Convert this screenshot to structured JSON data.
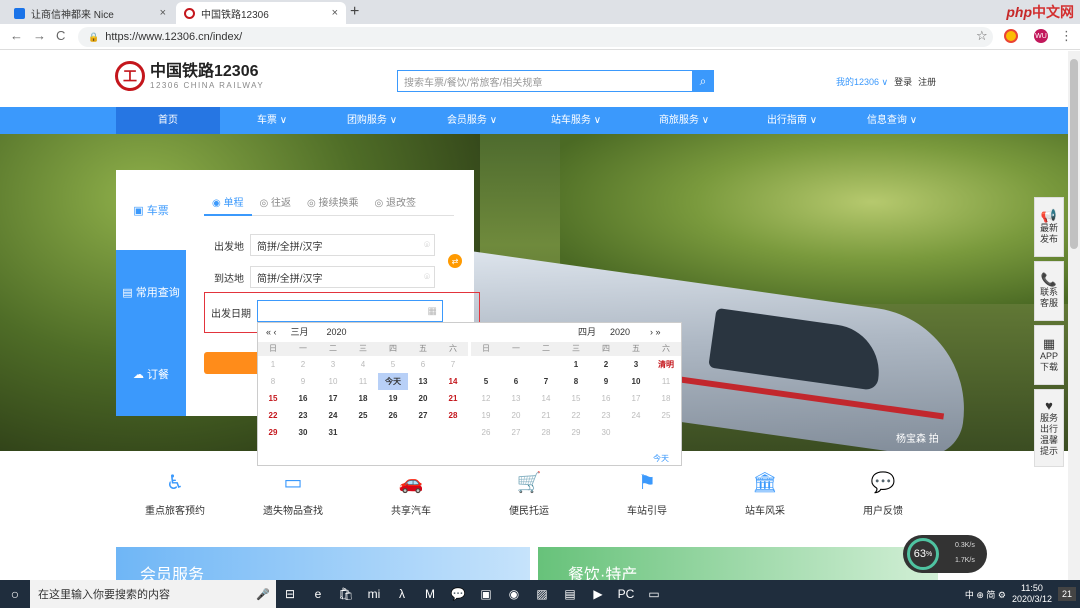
{
  "browser": {
    "tabs": [
      {
        "title": "让商信神都来 Nice"
      },
      {
        "title": "中国铁路12306"
      }
    ],
    "new_tab": "+",
    "close": "×",
    "url": "https://www.12306.cn/index/",
    "lock": "🔒",
    "nav_back": "←",
    "nav_forward": "→",
    "nav_reload": "C",
    "star": "☆",
    "ext_label": "WU",
    "menu": "⋮",
    "php_logo": {
      "a": "php",
      "b": "中文网"
    }
  },
  "site": {
    "brand_title": "中国铁路12306",
    "brand_sub": "12306 CHINA RAILWAY",
    "search_placeholder": "搜索车票/餐饮/常旅客/相关规章",
    "my_account": "我的12306 ∨",
    "login": "登录",
    "register": "注册",
    "nav": [
      "首页",
      "车票 ∨",
      "团购服务 ∨",
      "会员服务 ∨",
      "站车服务 ∨",
      "商旅服务 ∨",
      "出行指南 ∨",
      "信息查询 ∨"
    ],
    "hero_caption": "杨宝森  拍"
  },
  "sidebar": [
    {
      "icon": "📢",
      "label": "最新\n发布"
    },
    {
      "icon": "📞",
      "label": "联系\n客服"
    },
    {
      "icon": "▦",
      "label": "APP\n下载"
    },
    {
      "icon": "♥",
      "label": "服务\n出行\n温馨\n提示"
    }
  ],
  "booking": {
    "left_tabs": [
      {
        "icon": "▣",
        "label": "车票"
      },
      {
        "icon": "▤",
        "label": "常用查询"
      },
      {
        "icon": "☁",
        "label": "订餐"
      }
    ],
    "trip_tabs": [
      "◉ 单程",
      "◎ 往返",
      "◎ 接续换乘",
      "◎ 退改签"
    ],
    "from_label": "出发地",
    "from_placeholder": "简拼/全拼/汉字",
    "to_label": "到达地",
    "to_placeholder": "简拼/全拼/汉字",
    "swap": "⇄",
    "date_label": "出发日期",
    "date_icon": "▦"
  },
  "calendar": {
    "left": {
      "prev": "«  ‹",
      "month": "三月",
      "year": "2020"
    },
    "right": {
      "month": "四月",
      "year": "2020",
      "next": "›  »"
    },
    "dow": [
      "日",
      "一",
      "二",
      "三",
      "四",
      "五",
      "六"
    ],
    "march": [
      [
        "1",
        "dim"
      ],
      [
        "2",
        "dim"
      ],
      [
        "3",
        "dim"
      ],
      [
        "4",
        "dim"
      ],
      [
        "5",
        "dim"
      ],
      [
        "6",
        "dim"
      ],
      [
        "7",
        "dim"
      ],
      [
        "8",
        "dim"
      ],
      [
        "9",
        "dim"
      ],
      [
        "10",
        "dim"
      ],
      [
        "11",
        "dim"
      ],
      [
        "今天",
        "today"
      ],
      [
        "13",
        ""
      ],
      [
        "14",
        "we"
      ],
      [
        "15",
        "we"
      ],
      [
        "16",
        ""
      ],
      [
        "17",
        ""
      ],
      [
        "18",
        ""
      ],
      [
        "19",
        ""
      ],
      [
        "20",
        ""
      ],
      [
        "21",
        "we"
      ],
      [
        "22",
        "we"
      ],
      [
        "23",
        ""
      ],
      [
        "24",
        ""
      ],
      [
        "25",
        ""
      ],
      [
        "26",
        ""
      ],
      [
        "27",
        ""
      ],
      [
        "28",
        "we"
      ],
      [
        "29",
        "we"
      ],
      [
        "30",
        ""
      ],
      [
        "31",
        ""
      ],
      [
        "",
        ""
      ],
      [
        "",
        ""
      ],
      [
        "",
        ""
      ],
      [
        "",
        ""
      ]
    ],
    "april": [
      [
        "",
        ""
      ],
      [
        "",
        ""
      ],
      [
        "",
        ""
      ],
      [
        "1",
        ""
      ],
      [
        "2",
        ""
      ],
      [
        "3",
        ""
      ],
      [
        "清明",
        "we"
      ],
      [
        "5",
        ""
      ],
      [
        "6",
        ""
      ],
      [
        "7",
        ""
      ],
      [
        "8",
        ""
      ],
      [
        "9",
        ""
      ],
      [
        "10",
        ""
      ],
      [
        "11",
        "dim"
      ],
      [
        "12",
        "dim"
      ],
      [
        "13",
        "dim"
      ],
      [
        "14",
        "dim"
      ],
      [
        "15",
        "dim"
      ],
      [
        "16",
        "dim"
      ],
      [
        "17",
        "dim"
      ],
      [
        "18",
        "dim"
      ],
      [
        "19",
        "dim"
      ],
      [
        "20",
        "dim"
      ],
      [
        "21",
        "dim"
      ],
      [
        "22",
        "dim"
      ],
      [
        "23",
        "dim"
      ],
      [
        "24",
        "dim"
      ],
      [
        "25",
        "dim"
      ],
      [
        "26",
        "dim"
      ],
      [
        "27",
        "dim"
      ],
      [
        "28",
        "dim"
      ],
      [
        "29",
        "dim"
      ],
      [
        "30",
        "dim"
      ],
      [
        "",
        ""
      ],
      [
        "",
        ""
      ]
    ],
    "today_link": "今天"
  },
  "services": [
    {
      "icon": "♿",
      "label": "重点旅客预约"
    },
    {
      "icon": "▭",
      "label": "遗失物品查找"
    },
    {
      "icon": "🚗",
      "label": "共享汽车"
    },
    {
      "icon": "🛒",
      "label": "便民托运"
    },
    {
      "icon": "⚑",
      "label": "车站引导"
    },
    {
      "icon": "🏛",
      "label": "站车风采"
    },
    {
      "icon": "💬",
      "label": "用户反馈"
    }
  ],
  "promos": [
    "会员服务",
    "餐饮·特产"
  ],
  "speed": {
    "value": "63",
    "unit": "%",
    "up": "0.3K/s",
    "down": "1.7K/s"
  },
  "taskbar": {
    "search": "在这里输入你要搜索的内容",
    "mic": "🎤",
    "apps": [
      "⊟",
      "e",
      "🛍",
      "mi",
      "λ",
      "M",
      "💬",
      "▣",
      "◉",
      "▨",
      "▤",
      "▶",
      "PC",
      "▭"
    ],
    "tray": "中 ⊕ 简 ⚙",
    "time": "11:50",
    "date": "2020/3/12",
    "notif": "21"
  }
}
